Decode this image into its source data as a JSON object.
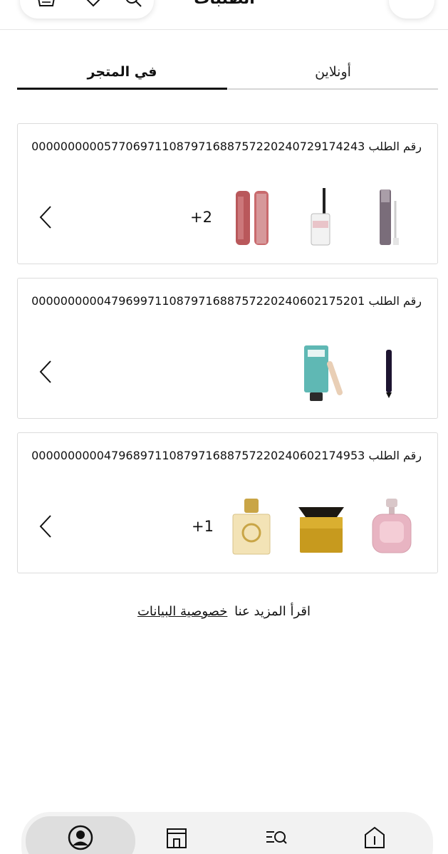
{
  "header": {
    "title": "الطلبات",
    "icons": [
      "basket-icon",
      "heart-icon",
      "search-icon",
      "chevron-right-icon"
    ]
  },
  "tabs": [
    {
      "label": "أونلاين",
      "active": false
    },
    {
      "label": "في المتجر",
      "active": true
    }
  ],
  "orders": [
    {
      "label": "رقم الطلب",
      "number": "0000000000577069711087971688757220240729174243",
      "products": [
        "eyeshadow-primer-wand",
        "mascara",
        "lip-gloss"
      ],
      "extra": "+2"
    },
    {
      "label": "رقم الطلب",
      "number": "0000000000479699711087971688757220240602175201",
      "products": [
        "eyeliner-pen",
        "pore-primer-tube"
      ],
      "extra": ""
    },
    {
      "label": "رقم الطلب",
      "number": "0000000000479689711087971688757220240602174953",
      "products": [
        "pink-perfume-bottle",
        "black-perfume-bottle",
        "gold-perfume-bottle"
      ],
      "extra": "+1"
    }
  ],
  "privacy": {
    "text": "اقرأ المزيد عنا",
    "link": "خصوصية البيانات"
  },
  "bottom_nav": [
    "account-icon",
    "store-icon",
    "search-list-icon",
    "home-icon"
  ],
  "colors": {
    "active_tab_underline": "#111111",
    "nav_bg": "#f2f2f2",
    "nav_active": "#dedede"
  }
}
